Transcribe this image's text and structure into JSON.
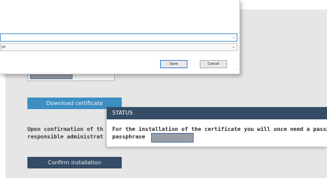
{
  "dialog": {
    "select2_value": "ge",
    "save_label": "Save",
    "cancel_label": "Cancel"
  },
  "main": {
    "download_label": "Download certificate",
    "confirmation_lines": [
      "Upon confirmation of th",
      "responsible administrat"
    ],
    "confirm_label": "Confirm installation"
  },
  "status": {
    "title": "STATUS",
    "message_line1": "For the installation of the certificate you will once need a passpl",
    "message_line2": "passphrase"
  },
  "icons": {
    "dropdown_chevron": "chevron-down-icon",
    "resize_grip": "resize-grip-icon"
  }
}
